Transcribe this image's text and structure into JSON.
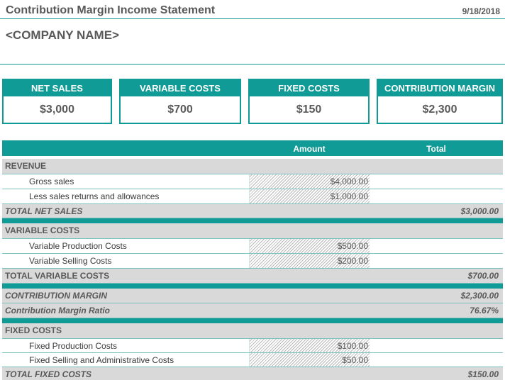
{
  "header": {
    "title": "Contribution Margin Income Statement",
    "date": "9/18/2018",
    "company": "<COMPANY NAME>"
  },
  "cards": [
    {
      "label": "NET SALES",
      "value": "$3,000"
    },
    {
      "label": "VARIABLE COSTS",
      "value": "$700"
    },
    {
      "label": "FIXED COSTS",
      "value": "$150"
    },
    {
      "label": "CONTRIBUTION MARGIN",
      "value": "$2,300"
    }
  ],
  "table": {
    "col_amount": "Amount",
    "col_total": "Total",
    "revenue": {
      "heading": "REVENUE",
      "gross_label": "Gross sales",
      "gross_amount": "$4,000.00",
      "returns_label": "Less sales returns and allowances",
      "returns_amount": "$1,000.00",
      "total_label": "TOTAL NET SALES",
      "total_value": "$3,000.00"
    },
    "variable": {
      "heading": "VARIABLE  COSTS",
      "prod_label": "Variable Production Costs",
      "prod_amount": "$500.00",
      "sell_label": "Variable Selling Costs",
      "sell_amount": "$200.00",
      "total_label": "TOTAL VARIABLE  COSTS",
      "total_value": "$700.00"
    },
    "margin": {
      "label": "CONTRIBUTION MARGIN",
      "value": "$2,300.00",
      "ratio_label": "Contribution Margin Ratio",
      "ratio_value": "76.67%"
    },
    "fixed": {
      "heading": "FIXED COSTS",
      "prod_label": "Fixed Production Costs",
      "prod_amount": "$100.00",
      "sell_label": "Fixed Selling and Administrative Costs",
      "sell_amount": "$50.00",
      "total_label": "TOTAL FIXED COSTS",
      "total_value": "$150.00"
    }
  }
}
